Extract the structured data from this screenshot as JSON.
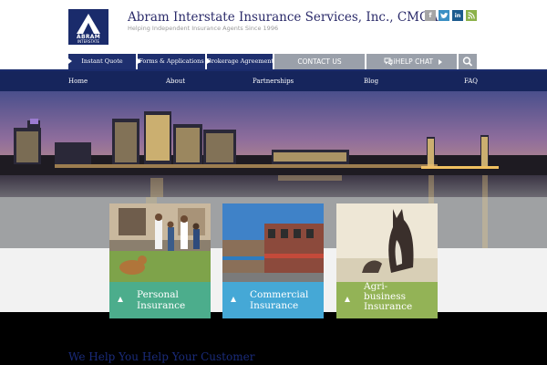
{
  "header": {
    "logo_line1": "ABRAM",
    "logo_line2": "INTERSTATE",
    "company_name": "Abram Interstate Insurance Services, Inc., CMGA",
    "tagline": "Helping Independent Insurance Agents Since 1996",
    "social": [
      {
        "icon": "facebook-icon",
        "glyph": "f",
        "color": "#a5a5a5"
      },
      {
        "icon": "twitter-icon",
        "glyph": "t",
        "color": "#3a8fc4"
      },
      {
        "icon": "linkedin-icon",
        "glyph": "in",
        "color": "#1d5b8e"
      },
      {
        "icon": "rss-icon",
        "glyph": "~",
        "color": "#8cb24a"
      }
    ]
  },
  "topnav": {
    "instant_quote": "Instant Quote",
    "forms": "Forms & Applications",
    "brokerage": "Brokerage Agreement",
    "contact": "CONTACT US",
    "help_chat": "iHELP CHAT"
  },
  "mainnav": {
    "home": "Home",
    "about": "About",
    "partnerships": "Partnerships",
    "blog": "Blog",
    "faq": "FAQ"
  },
  "cards": [
    {
      "line1": "Personal",
      "line2": "Insurance",
      "color": "#4cad8c"
    },
    {
      "line1": "Commercial",
      "line2": "Insurance",
      "color": "#45a8d6"
    },
    {
      "line1": "Agri-",
      "line2": "business",
      "line3": "Insurance",
      "color": "#93b356"
    }
  ],
  "bottom_heading": "We Help You Help Your Customer"
}
